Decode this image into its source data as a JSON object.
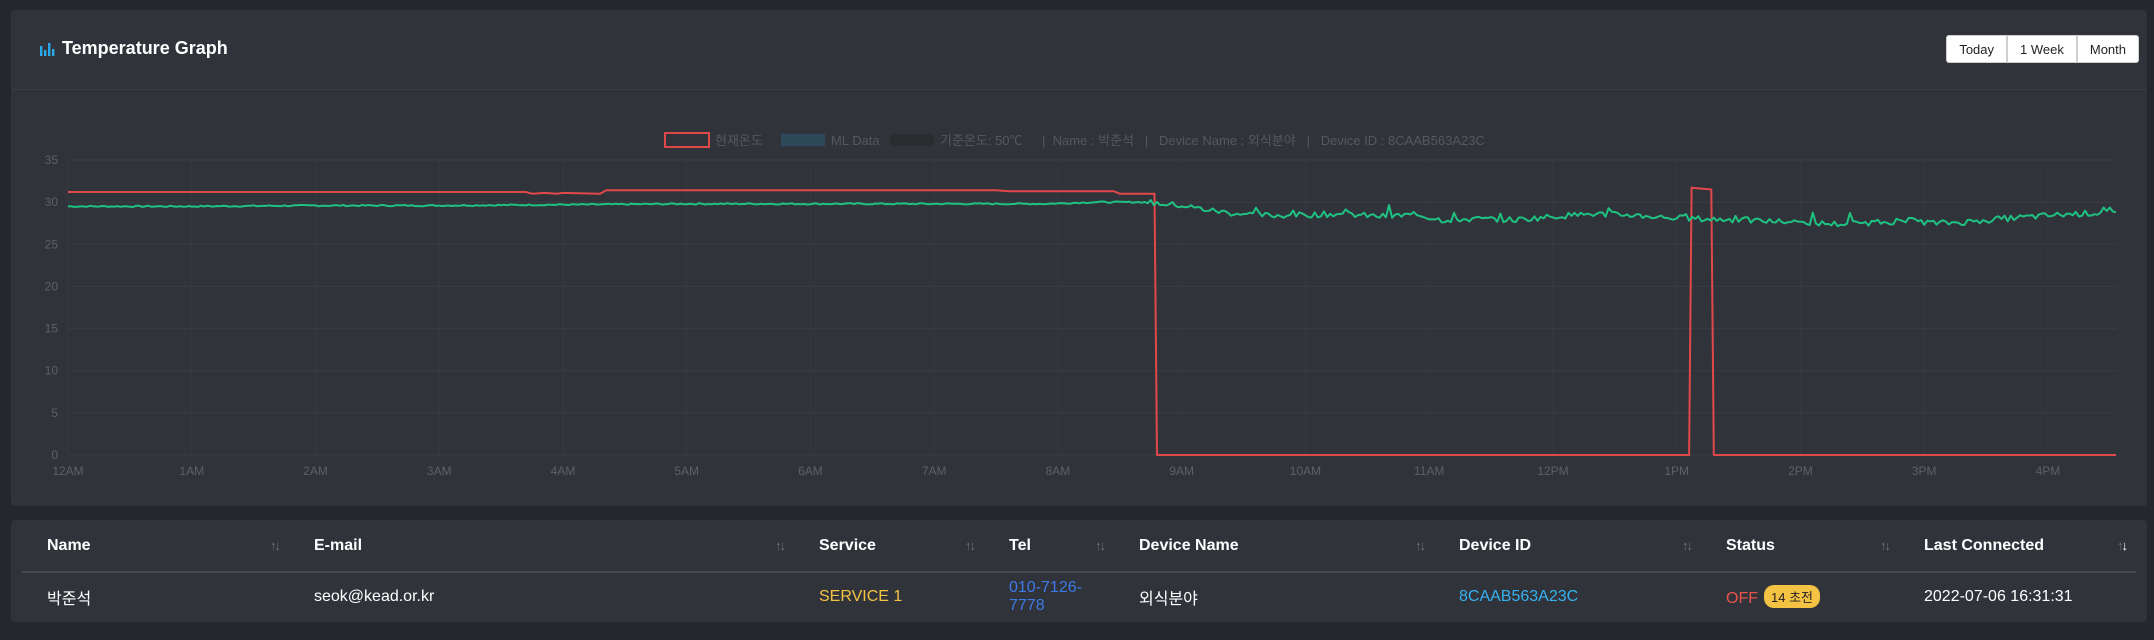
{
  "header": {
    "title": "Temperature Graph",
    "buttons": [
      "Today",
      "1 Week",
      "Month"
    ]
  },
  "chart_data": {
    "type": "line",
    "legend": [
      {
        "label": "현재온도",
        "color": "#e0484a"
      },
      {
        "label": "ML Data",
        "color": "#2e6d8e"
      },
      {
        "label": "기준온도: 50℃",
        "color": "#2a2c30"
      }
    ],
    "legend_info": "|  Name : 박준석   |   Device Name : 외식분야   |   Device ID : 8CAAB563A23C",
    "x_ticks": [
      "12AM",
      "1AM",
      "2AM",
      "3AM",
      "4AM",
      "5AM",
      "6AM",
      "7AM",
      "8AM",
      "9AM",
      "10AM",
      "11AM",
      "12PM",
      "1PM",
      "2PM",
      "3PM",
      "4PM"
    ],
    "y_ticks": [
      0,
      5,
      10,
      15,
      20,
      25,
      30,
      35
    ],
    "ylim": [
      0,
      35
    ],
    "xlim_hours": [
      0,
      16.55
    ],
    "series": [
      {
        "name": "현재온도",
        "color": "#e0484a",
        "points": [
          [
            0,
            31.2
          ],
          [
            3.7,
            31.2
          ],
          [
            3.75,
            31.0
          ],
          [
            3.85,
            31.1
          ],
          [
            3.95,
            31.0
          ],
          [
            4.0,
            31.1
          ],
          [
            4.3,
            31.0
          ],
          [
            4.35,
            31.4
          ],
          [
            7.5,
            31.4
          ],
          [
            7.6,
            31.3
          ],
          [
            8.45,
            31.3
          ],
          [
            8.5,
            31.0
          ],
          [
            8.78,
            31.0
          ],
          [
            8.8,
            0
          ],
          [
            13.1,
            0
          ],
          [
            13.12,
            31.7
          ],
          [
            13.28,
            31.5
          ],
          [
            13.3,
            0
          ],
          [
            16.55,
            0
          ]
        ]
      },
      {
        "name": "",
        "color": "#1fc281",
        "points": [
          [
            0,
            29.5
          ],
          [
            1.0,
            29.5
          ],
          [
            2.0,
            29.6
          ],
          [
            3.0,
            29.6
          ],
          [
            4.0,
            29.7
          ],
          [
            5.0,
            29.8
          ],
          [
            6.0,
            29.8
          ],
          [
            7.0,
            29.8
          ],
          [
            7.9,
            29.8
          ],
          [
            8.3,
            30.0
          ],
          [
            8.7,
            30.0
          ],
          [
            9.0,
            29.6
          ],
          [
            9.2,
            29.1
          ],
          [
            9.4,
            28.7
          ],
          [
            9.7,
            28.4
          ],
          [
            10.0,
            28.5
          ],
          [
            10.3,
            28.6
          ],
          [
            10.6,
            28.3
          ],
          [
            10.9,
            28.5
          ],
          [
            11.1,
            27.9
          ],
          [
            11.4,
            28.0
          ],
          [
            11.7,
            27.9
          ],
          [
            12.0,
            28.3
          ],
          [
            12.3,
            28.6
          ],
          [
            12.6,
            28.5
          ],
          [
            12.9,
            28.2
          ],
          [
            13.2,
            28.0
          ],
          [
            13.5,
            27.9
          ],
          [
            13.8,
            27.7
          ],
          [
            14.0,
            27.6
          ],
          [
            14.3,
            27.4
          ],
          [
            14.6,
            27.6
          ],
          [
            14.9,
            27.8
          ],
          [
            15.1,
            27.5
          ],
          [
            15.3,
            27.6
          ],
          [
            15.6,
            28.0
          ],
          [
            15.9,
            28.3
          ],
          [
            16.2,
            28.6
          ],
          [
            16.55,
            28.8
          ]
        ]
      }
    ]
  },
  "table": {
    "columns": [
      "Name",
      "E-mail",
      "Service",
      "Tel",
      "Device Name",
      "Device ID",
      "Status",
      "Last Connected"
    ],
    "rows": [
      {
        "name": "박준석",
        "email": "seok@kead.or.kr",
        "service": "SERVICE 1",
        "tel": "010-7126-7778",
        "device_name": "외식분야",
        "device_id": "8CAAB563A23C",
        "status": "OFF",
        "status_badge": "14 초전",
        "last_connected": "2022-07-06 16:31:31"
      }
    ]
  },
  "colors": {
    "background": "#25272c",
    "card": "#30333a",
    "service": "#f5c344",
    "tel": "#3d7be8",
    "device_id": "#37b2f0",
    "status_off": "#e9534a"
  }
}
